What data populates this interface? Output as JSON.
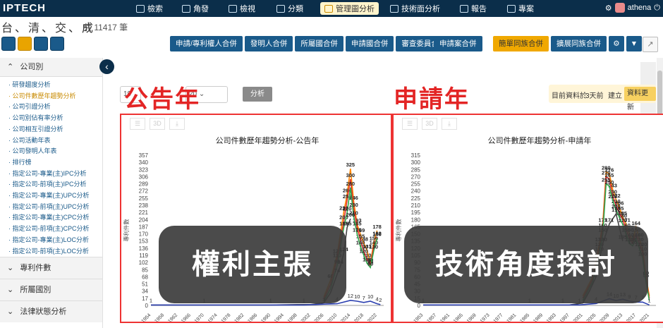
{
  "app": {
    "logo": "IPTECH",
    "nav": [
      {
        "label": "檢索",
        "icon": "search-icon"
      },
      {
        "label": "角發",
        "icon": "folder-icon"
      },
      {
        "label": "檢視",
        "icon": "view-icon"
      },
      {
        "label": "分類",
        "icon": "tag-icon"
      },
      {
        "label": "管理圖分析",
        "icon": "chart-icon",
        "active": true
      },
      {
        "label": "技術面分析",
        "icon": "tech-icon"
      },
      {
        "label": "報告",
        "icon": "report-icon"
      },
      {
        "label": "專案",
        "icon": "project-icon"
      }
    ],
    "user": "athena",
    "accent": "#0b2e4a",
    "highlight": "#f0a800"
  },
  "header": {
    "title": "台、清、交、成",
    "count": "共 11417 筆"
  },
  "toolbar": {
    "buttons": [
      "申請/專利權人合併",
      "發明人合併",
      "所屬國合併",
      "申請國合併",
      "審查委員合併"
    ],
    "buttons2": [
      "申請案合併"
    ],
    "buttons3": [
      {
        "label": "簡單同族合併",
        "active": true
      },
      {
        "label": "擴展同族合併",
        "active": false
      }
    ]
  },
  "sidebar": {
    "section": "公司別",
    "items": [
      "研發趨度分析",
      "公司件數歷年趨勢分析",
      "公司引證分析",
      "公司別佔有率分析",
      "公司相互引證分析",
      "公司活動年表",
      "公司發明人年表",
      "排行榜",
      "指定公司-專業(主)IPC分析",
      "指定公司-前項(主)IPC分析",
      "指定公司-專業(主)UPC分析",
      "指定公司-前項(主)UPC分析",
      "指定公司-專業(主)CPC分析",
      "指定公司-前項(主)CPC分析",
      "指定公司-專業(主)LOC分析",
      "指定公司-前項(主)LOC分析"
    ],
    "active_index": 1,
    "sections": [
      "專利件數",
      "所屬國別",
      "法律狀態分析"
    ]
  },
  "controls": {
    "year_from": "19",
    "year_to": "20",
    "analyze_label": "分析",
    "status_text1": "目前資料於",
    "status_text2": "3天前",
    "status_text3": "建立",
    "update_label": "資料更新"
  },
  "annotations": {
    "left_red": "公告年",
    "right_red": "申請年",
    "left_overlay": "權利主張",
    "right_overlay": "技術角度探討"
  },
  "chart_data": [
    {
      "type": "line",
      "title": "公司件數歷年趨勢分析-公告年",
      "ylabel": "專利件數",
      "ylim": [
        0,
        357
      ],
      "yticks": [
        0,
        17,
        34,
        51,
        68,
        85,
        102,
        119,
        136,
        153,
        170,
        187,
        204,
        221,
        238,
        255,
        272,
        289,
        306,
        323,
        340,
        357
      ],
      "xticks": [
        "1954",
        "1958",
        "1962",
        "1966",
        "1970",
        "1974",
        "1978",
        "1982",
        "1986",
        "1990",
        "1994",
        "1998",
        "2002",
        "2006",
        "2010",
        "2014",
        "2018",
        "2022"
      ],
      "series": [
        {
          "color": "#ff8800",
          "x": [
            2006,
            2008,
            2010,
            2012,
            2013,
            2014,
            2015,
            2016,
            2017,
            2018,
            2019,
            2020,
            2021,
            2022
          ],
          "y": [
            20,
            60,
            120,
            222,
            264,
            325,
            246,
            193,
            169,
            148,
            131,
            99,
            150,
            178
          ]
        },
        {
          "color": "#e33333",
          "x": [
            2006,
            2008,
            2010,
            2012,
            2013,
            2014,
            2015,
            2016,
            2017,
            2018,
            2019,
            2020,
            2021,
            2022
          ],
          "y": [
            15,
            50,
            110,
            200,
            250,
            300,
            230,
            185,
            155,
            130,
            110,
            95,
            140,
            162
          ]
        },
        {
          "color": "#2ea84b",
          "x": [
            2006,
            2008,
            2010,
            2012,
            2013,
            2014,
            2015,
            2016,
            2017,
            2018,
            2019,
            2020,
            2021,
            2022
          ],
          "y": [
            10,
            40,
            95,
            185,
            220,
            280,
            210,
            170,
            140,
            120,
            100,
            90,
            130,
            160
          ]
        },
        {
          "color": "#444444",
          "x": [
            1954,
            1970,
            1990,
            1998,
            2002,
            2004,
            2006,
            2008,
            2010,
            2011,
            2012,
            2013,
            2014
          ],
          "y": [
            1,
            1,
            1,
            2,
            2,
            4,
            6,
            30,
            74,
            94,
            124,
            185,
            206
          ]
        },
        {
          "color": "#2b3fb0",
          "x": [
            1954,
            1970,
            1990,
            2000,
            2006,
            2010,
            2014,
            2016,
            2018,
            2020,
            2022,
            2023
          ],
          "y": [
            1,
            1,
            1,
            1,
            3,
            4,
            12,
            10,
            7,
            10,
            4,
            2
          ]
        }
      ],
      "labels": [
        1,
        1,
        1,
        1,
        1,
        1,
        11,
        1,
        22,
        2,
        4,
        6,
        30,
        74,
        94,
        99,
        124,
        185,
        206,
        222,
        264,
        300,
        325,
        246,
        193,
        169,
        148,
        131,
        99,
        178,
        162,
        12,
        10,
        7,
        6,
        10,
        4,
        22
      ]
    },
    {
      "type": "line",
      "title": "公司件數歷年趨勢分析-申請年",
      "ylabel": "專利件數",
      "ylim": [
        0,
        315
      ],
      "yticks": [
        0,
        15,
        30,
        45,
        60,
        75,
        90,
        105,
        120,
        135,
        150,
        165,
        180,
        195,
        210,
        225,
        240,
        255,
        270,
        285,
        300,
        315
      ],
      "xticks": [
        "1953",
        "1957",
        "1961",
        "1965",
        "1969",
        "1973",
        "1977",
        "1981",
        "1985",
        "1989",
        "1993",
        "1997",
        "2001",
        "2005",
        "2009",
        "2013",
        "2017",
        "2021"
      ],
      "series": [
        {
          "color": "#ff8800",
          "x": [
            2001,
            2004,
            2006,
            2007,
            2008,
            2009,
            2010,
            2011,
            2012,
            2013,
            2014,
            2015,
            2016,
            2017,
            2018,
            2019,
            2020,
            2021
          ],
          "y": [
            20,
            60,
            130,
            171,
            280,
            276,
            243,
            222,
            206,
            185,
            171,
            150,
            135,
            164,
            140,
            120,
            60,
            20
          ]
        },
        {
          "color": "#e33333",
          "x": [
            2001,
            2004,
            2006,
            2007,
            2008,
            2009,
            2010,
            2011,
            2012,
            2013,
            2014,
            2015,
            2016,
            2017,
            2018,
            2019,
            2020,
            2021
          ],
          "y": [
            15,
            55,
            120,
            160,
            270,
            265,
            230,
            210,
            195,
            180,
            160,
            140,
            130,
            150,
            130,
            110,
            55,
            15
          ]
        },
        {
          "color": "#2ea84b",
          "x": [
            2001,
            2004,
            2006,
            2007,
            2008,
            2009,
            2010,
            2011,
            2012,
            2013,
            2014,
            2015,
            2016,
            2017,
            2018,
            2019,
            2020,
            2021
          ],
          "y": [
            10,
            50,
            110,
            150,
            255,
            250,
            220,
            200,
            185,
            170,
            150,
            130,
            125,
            140,
            120,
            100,
            50,
            10
          ]
        },
        {
          "color": "#444444",
          "x": [
            1953,
            1975,
            1985,
            1993,
            1997,
            2001,
            2003,
            2005,
            2007,
            2009,
            2011,
            2013
          ],
          "y": [
            1,
            1,
            1,
            1,
            1,
            5,
            30,
            60,
            130,
            171,
            192,
            135
          ]
        },
        {
          "color": "#2b3fb0",
          "x": [
            1953,
            1985,
            1995,
            2000,
            2005,
            2009,
            2011,
            2013,
            2015,
            2017,
            2019,
            2021
          ],
          "y": [
            1,
            1,
            1,
            1,
            4,
            14,
            10,
            13,
            9,
            7,
            7,
            1
          ]
        }
      ],
      "labels": [
        1,
        1,
        1,
        1,
        1,
        1,
        1,
        1,
        1,
        2,
        5,
        10,
        14,
        10,
        13,
        7,
        7,
        9,
        7,
        280,
        276,
        243,
        222,
        206,
        171,
        192,
        164,
        135,
        130
      ]
    }
  ]
}
